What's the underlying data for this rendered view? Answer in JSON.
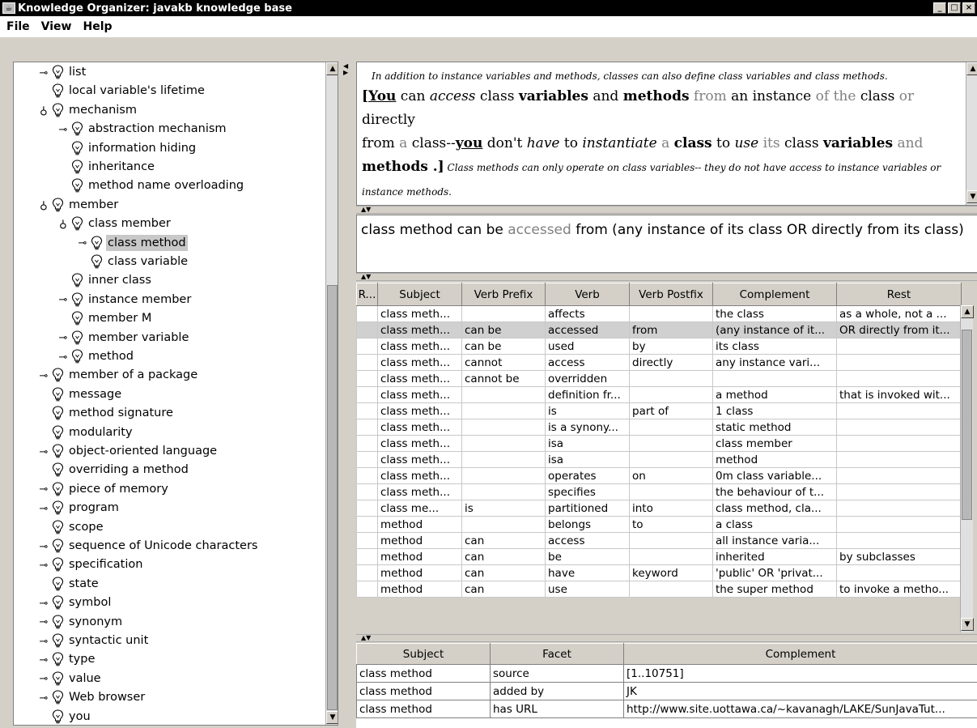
{
  "window": {
    "title": "Knowledge Organizer: javakb knowledge base",
    "minimize": "_",
    "maximize": "□",
    "close": "×"
  },
  "menu": [
    "File",
    "View",
    "Help"
  ],
  "tree": {
    "items": [
      {
        "label": "list",
        "indent": 0,
        "toggle": "collapsed"
      },
      {
        "label": "local variable's lifetime",
        "indent": 0,
        "toggle": "leaf"
      },
      {
        "label": "mechanism",
        "indent": 0,
        "toggle": "expanded"
      },
      {
        "label": "abstraction mechanism",
        "indent": 1,
        "toggle": "collapsed"
      },
      {
        "label": "information hiding",
        "indent": 1,
        "toggle": "leaf"
      },
      {
        "label": "inheritance",
        "indent": 1,
        "toggle": "leaf"
      },
      {
        "label": "method name overloading",
        "indent": 1,
        "toggle": "leaf"
      },
      {
        "label": "member",
        "indent": 0,
        "toggle": "expanded"
      },
      {
        "label": "class member",
        "indent": 1,
        "toggle": "expanded"
      },
      {
        "label": "class method",
        "indent": 2,
        "toggle": "collapsed",
        "selected": true
      },
      {
        "label": "class variable",
        "indent": 2,
        "toggle": "leaf"
      },
      {
        "label": "inner class",
        "indent": 1,
        "toggle": "leaf"
      },
      {
        "label": "instance member",
        "indent": 1,
        "toggle": "collapsed"
      },
      {
        "label": "member M",
        "indent": 1,
        "toggle": "leaf"
      },
      {
        "label": "member variable",
        "indent": 1,
        "toggle": "collapsed"
      },
      {
        "label": "method",
        "indent": 1,
        "toggle": "collapsed"
      },
      {
        "label": "member of a package",
        "indent": 0,
        "toggle": "collapsed"
      },
      {
        "label": "message",
        "indent": 0,
        "toggle": "leaf"
      },
      {
        "label": "method signature",
        "indent": 0,
        "toggle": "leaf"
      },
      {
        "label": "modularity",
        "indent": 0,
        "toggle": "leaf"
      },
      {
        "label": "object-oriented language",
        "indent": 0,
        "toggle": "collapsed"
      },
      {
        "label": "overriding a method",
        "indent": 0,
        "toggle": "leaf"
      },
      {
        "label": "piece of memory",
        "indent": 0,
        "toggle": "collapsed"
      },
      {
        "label": "program",
        "indent": 0,
        "toggle": "collapsed"
      },
      {
        "label": "scope",
        "indent": 0,
        "toggle": "leaf"
      },
      {
        "label": "sequence of Unicode characters",
        "indent": 0,
        "toggle": "collapsed"
      },
      {
        "label": "specification",
        "indent": 0,
        "toggle": "collapsed"
      },
      {
        "label": "state",
        "indent": 0,
        "toggle": "leaf"
      },
      {
        "label": "symbol",
        "indent": 0,
        "toggle": "collapsed"
      },
      {
        "label": "synonym",
        "indent": 0,
        "toggle": "collapsed"
      },
      {
        "label": "syntactic unit",
        "indent": 0,
        "toggle": "collapsed"
      },
      {
        "label": "type",
        "indent": 0,
        "toggle": "collapsed"
      },
      {
        "label": "value",
        "indent": 0,
        "toggle": "collapsed"
      },
      {
        "label": "Web browser",
        "indent": 0,
        "toggle": "collapsed"
      },
      {
        "label": "you",
        "indent": 0,
        "toggle": "leaf"
      }
    ]
  },
  "source_text": {
    "intro": "In addition to instance variables and methods, classes can also define class variables and class methods.",
    "open_bracket": "[",
    "w_you": "You",
    "w_can": " can ",
    "w_access": "access",
    "w_class1": " class ",
    "w_variables1": "variables",
    "w_and1": " and ",
    "w_methods1": "methods",
    "w_from1": " from ",
    "w_an": "an",
    "w_instance": " instance ",
    "w_ofthe": "of the",
    "w_class2": " class ",
    "w_or": "or",
    "w_directly": " directly",
    "w_from2": "from",
    "w_a": " a ",
    "w_class3": "class--",
    "w_you2": "you",
    "w_dont": " don't ",
    "w_have": "have",
    "w_to1": " to ",
    "w_instantiate": "instantiate",
    "w_a2": " a ",
    "w_class4": "class",
    "w_to2": " to ",
    "w_use": "use",
    "w_its": " its ",
    "w_class5": "class ",
    "w_variables2": "variables",
    "w_and2": " and",
    "w_methods2": "methods",
    "close_bracket": " .]",
    "tail": " Class methods can only operate on class variables-- they do not have access to instance variables or instance methods."
  },
  "sentence": {
    "part1": "class method can be ",
    "part2": "accessed",
    "part3": " from (any instance of its class OR directly from its class)"
  },
  "table": {
    "headers": [
      "R...",
      "Subject",
      "Verb Prefix",
      "Verb",
      "Verb Postfix",
      "Complement",
      "Rest"
    ],
    "rows": [
      [
        "",
        "class meth...",
        "",
        "affects",
        "",
        "the class",
        "as a whole, not a ..."
      ],
      [
        "",
        "class meth...",
        "can be",
        "accessed",
        "from",
        "(any instance of it...",
        "OR directly from it..."
      ],
      [
        "",
        "class meth...",
        "can be",
        "used",
        "by",
        "its class",
        ""
      ],
      [
        "",
        "class meth...",
        "cannot",
        "access",
        "directly",
        "any instance vari...",
        ""
      ],
      [
        "",
        "class meth...",
        "cannot be",
        "overridden",
        "",
        "",
        ""
      ],
      [
        "",
        "class meth...",
        "",
        "definition fr...",
        "",
        "a method",
        "that is invoked wit..."
      ],
      [
        "",
        "class meth...",
        "",
        "is",
        "part of",
        "1 class",
        ""
      ],
      [
        "",
        "class meth...",
        "",
        "is a synony...",
        "",
        "static method",
        ""
      ],
      [
        "",
        "class meth...",
        "",
        "isa",
        "",
        "class member",
        ""
      ],
      [
        "",
        "class meth...",
        "",
        "isa",
        "",
        "method",
        ""
      ],
      [
        "",
        "class meth...",
        "",
        "operates",
        "on",
        "0m class variable...",
        ""
      ],
      [
        "",
        "class meth...",
        "",
        "specifies",
        "",
        "the behaviour of t...",
        ""
      ],
      [
        "",
        "class me...",
        "is",
        "partitioned",
        "into",
        "class method, cla...",
        ""
      ],
      [
        "",
        "method",
        "",
        "belongs",
        "to",
        "a class",
        ""
      ],
      [
        "",
        "method",
        "can",
        "access",
        "",
        "all instance varia...",
        ""
      ],
      [
        "",
        "method",
        "can",
        "be",
        "",
        "inherited",
        "by subclasses"
      ],
      [
        "",
        "method",
        "can",
        "have",
        "keyword",
        "'public' OR 'privat...",
        ""
      ],
      [
        "",
        "method",
        "can",
        "use",
        "",
        "the super method",
        "to invoke a metho..."
      ]
    ],
    "selected_row": 1
  },
  "facets": {
    "headers": [
      "Subject",
      "Facet",
      "Complement"
    ],
    "rows": [
      [
        "class method",
        "source",
        "[1..10751]"
      ],
      [
        "class method",
        "added by",
        "JK"
      ],
      [
        "class method",
        "has URL",
        "http://www.site.uottawa.ca/~kavanagh/LAKE/SunJavaTut..."
      ]
    ]
  }
}
